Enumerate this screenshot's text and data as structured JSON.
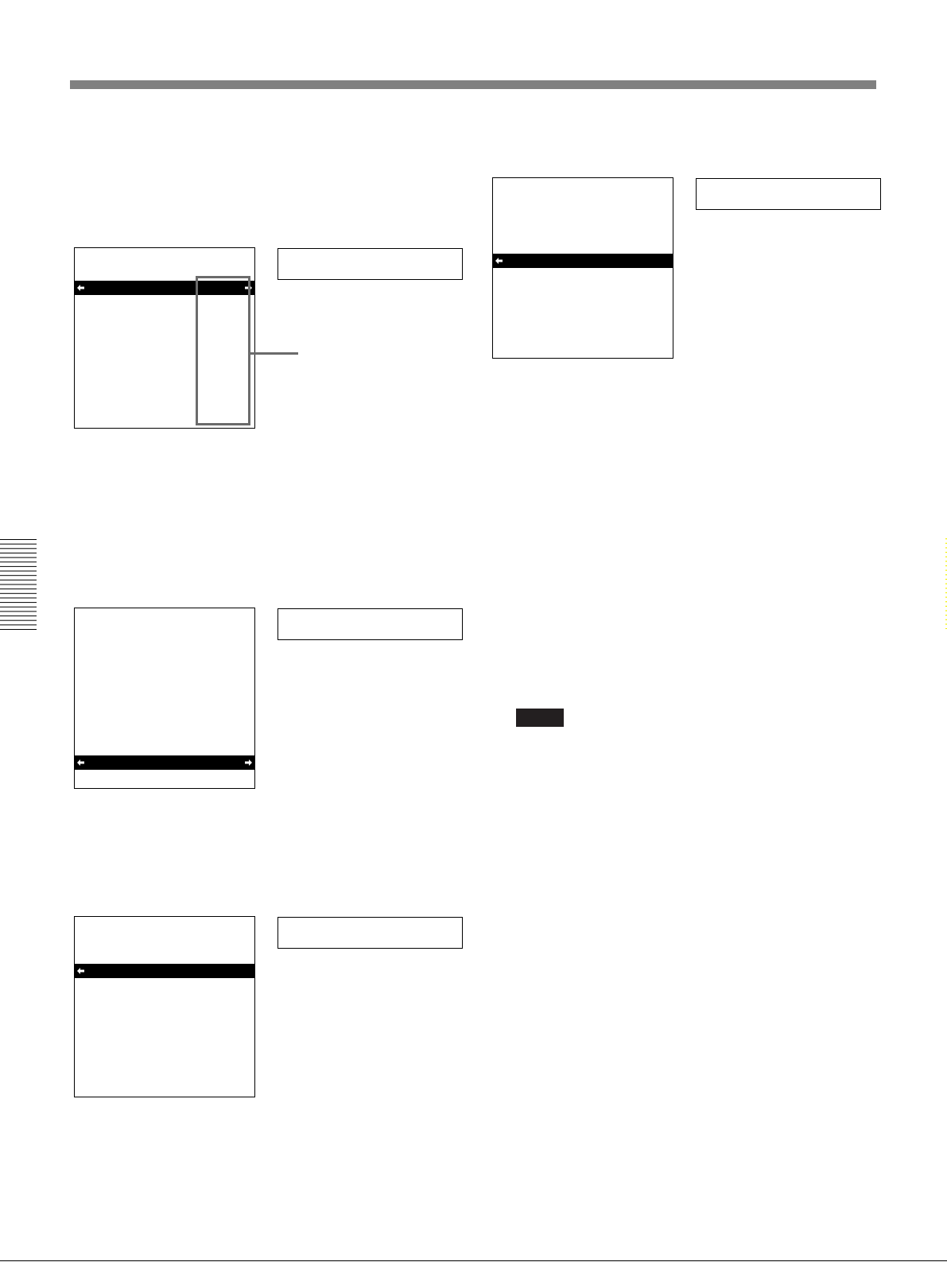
{
  "columns": [
    {
      "note_tag": false,
      "screens": [
        {
          "right_arrow": true,
          "column_callout": true,
          "rows": [
            {
              "selected": false
            },
            {
              "selected": false
            },
            {
              "selected": true
            },
            {
              "selected": false
            },
            {
              "selected": false
            },
            {
              "selected": false
            },
            {
              "selected": false
            },
            {
              "selected": false
            },
            {
              "selected": false
            },
            {
              "selected": false
            },
            {
              "selected": false
            },
            {
              "selected": false
            }
          ]
        },
        {
          "right_arrow": true,
          "column_callout": false,
          "rows": [
            {
              "selected": false
            },
            {
              "selected": false
            },
            {
              "selected": false
            },
            {
              "selected": false
            },
            {
              "selected": false
            },
            {
              "selected": false
            },
            {
              "selected": false
            },
            {
              "selected": false
            },
            {
              "selected": false
            },
            {
              "selected": false
            },
            {
              "selected": true
            },
            {
              "selected": false
            }
          ]
        },
        {
          "right_arrow": false,
          "column_callout": false,
          "rows": [
            {
              "selected": false
            },
            {
              "selected": false
            },
            {
              "selected": false
            },
            {
              "selected": true
            },
            {
              "selected": false
            },
            {
              "selected": false
            },
            {
              "selected": false
            },
            {
              "selected": false
            },
            {
              "selected": false
            },
            {
              "selected": false
            },
            {
              "selected": false
            },
            {
              "selected": false
            }
          ]
        }
      ]
    },
    {
      "note_tag": true,
      "screens": [
        {
          "right_arrow": false,
          "column_callout": false,
          "rows": [
            {
              "selected": false
            },
            {
              "selected": false
            },
            {
              "selected": false
            },
            {
              "selected": false
            },
            {
              "selected": false
            },
            {
              "selected": true
            },
            {
              "selected": false
            },
            {
              "selected": false
            },
            {
              "selected": false
            },
            {
              "selected": false
            },
            {
              "selected": false
            },
            {
              "selected": false
            }
          ]
        }
      ]
    }
  ]
}
